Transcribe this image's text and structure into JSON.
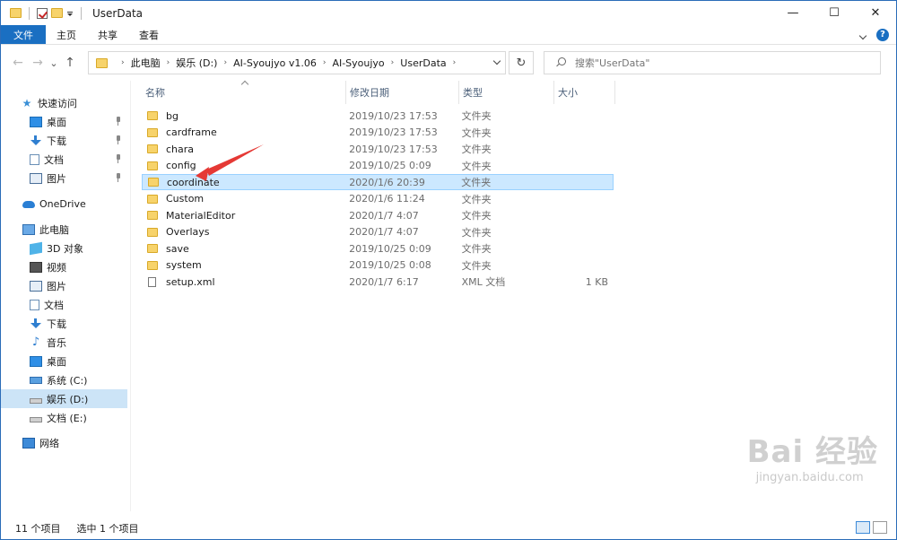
{
  "window": {
    "title": "UserData",
    "controls": {
      "minimize": "—",
      "maximize": "☐",
      "close": "✕"
    }
  },
  "ribbon": {
    "tabs": [
      "文件",
      "主页",
      "共享",
      "查看"
    ],
    "help": "?"
  },
  "nav": {
    "back": "←",
    "forward": "→",
    "recent": "⌄",
    "up": "↑"
  },
  "address": {
    "crumbs": [
      "此电脑",
      "娱乐 (D:)",
      "AI-Syoujyo v1.06",
      "AI-Syoujyo",
      "UserData"
    ],
    "refresh": "↻"
  },
  "search": {
    "placeholder": "搜索\"UserData\""
  },
  "sidebar": {
    "quick_access": "快速访问",
    "quick_items": [
      "桌面",
      "下载",
      "文档",
      "图片"
    ],
    "onedrive": "OneDrive",
    "this_pc": "此电脑",
    "pc_items": [
      "3D 对象",
      "视频",
      "图片",
      "文档",
      "下载",
      "音乐",
      "桌面",
      "系统 (C:)",
      "娱乐 (D:)",
      "文档 (E:)"
    ],
    "network": "网络"
  },
  "columns": {
    "name": "名称",
    "date": "修改日期",
    "type": "类型",
    "size": "大小"
  },
  "files": [
    {
      "name": "bg",
      "date": "2019/10/23 17:53",
      "type": "文件夹",
      "size": "",
      "kind": "folder"
    },
    {
      "name": "cardframe",
      "date": "2019/10/23 17:53",
      "type": "文件夹",
      "size": "",
      "kind": "folder"
    },
    {
      "name": "chara",
      "date": "2019/10/23 17:53",
      "type": "文件夹",
      "size": "",
      "kind": "folder"
    },
    {
      "name": "config",
      "date": "2019/10/25 0:09",
      "type": "文件夹",
      "size": "",
      "kind": "folder"
    },
    {
      "name": "coordinate",
      "date": "2020/1/6 20:39",
      "type": "文件夹",
      "size": "",
      "kind": "folder",
      "selected": true
    },
    {
      "name": "Custom",
      "date": "2020/1/6 11:24",
      "type": "文件夹",
      "size": "",
      "kind": "folder"
    },
    {
      "name": "MaterialEditor",
      "date": "2020/1/7 4:07",
      "type": "文件夹",
      "size": "",
      "kind": "folder"
    },
    {
      "name": "Overlays",
      "date": "2020/1/7 4:07",
      "type": "文件夹",
      "size": "",
      "kind": "folder"
    },
    {
      "name": "save",
      "date": "2019/10/25 0:09",
      "type": "文件夹",
      "size": "",
      "kind": "folder"
    },
    {
      "name": "system",
      "date": "2019/10/25 0:08",
      "type": "文件夹",
      "size": "",
      "kind": "folder"
    },
    {
      "name": "setup.xml",
      "date": "2020/1/7 6:17",
      "type": "XML 文档",
      "size": "1 KB",
      "kind": "file"
    }
  ],
  "status": {
    "count": "11 个项目",
    "selected": "选中 1 个项目"
  },
  "watermark": {
    "brand": "Bai 经验",
    "url": "jingyan.baidu.com"
  },
  "colors": {
    "accent": "#1a6fc2",
    "selection": "#cce8ff",
    "folder": "#f7d36b",
    "annotation": "#e53935"
  }
}
